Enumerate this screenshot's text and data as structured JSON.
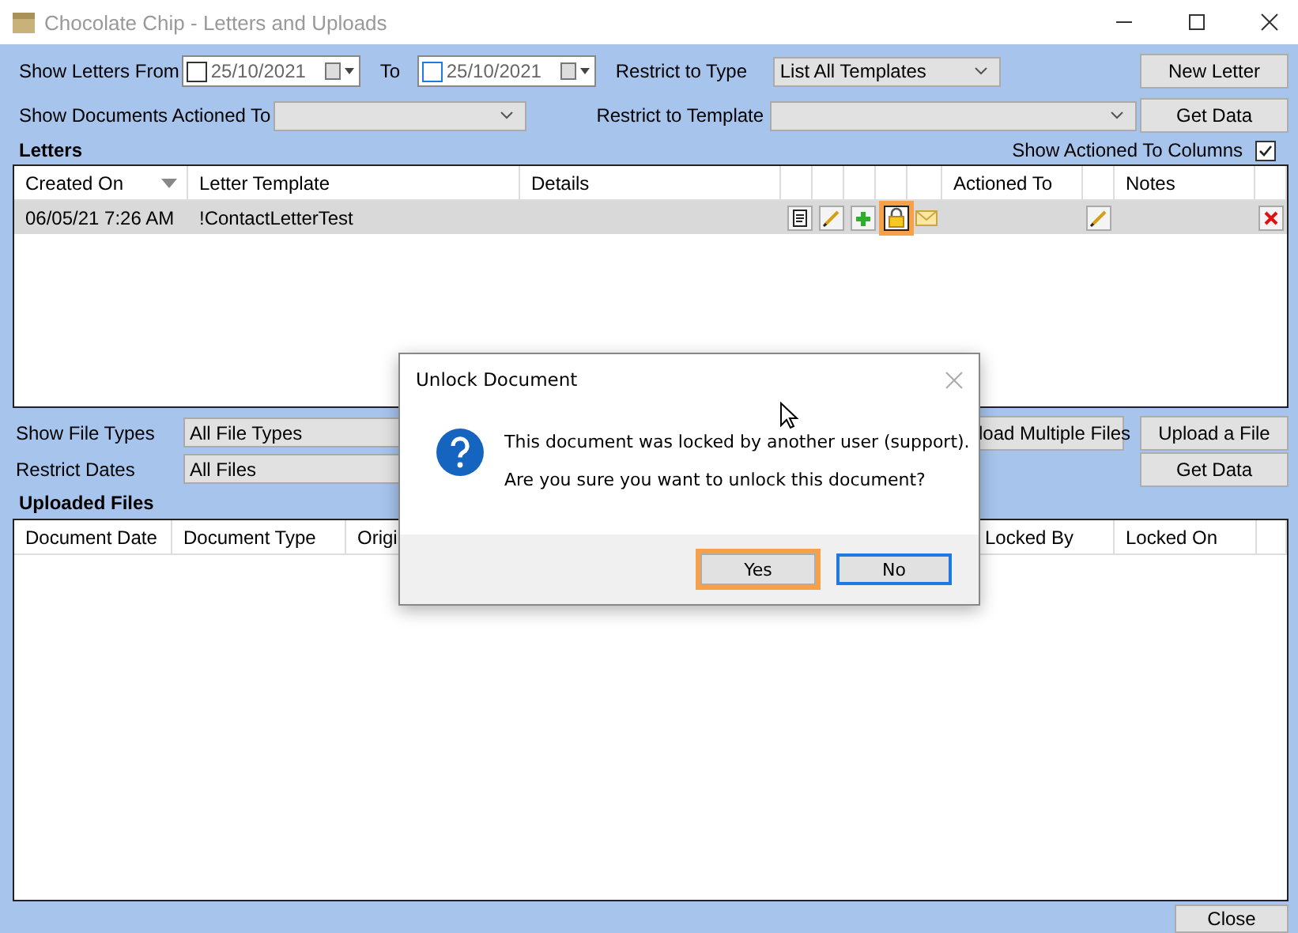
{
  "window": {
    "title": "Chocolate Chip - Letters and Uploads"
  },
  "letter_filters": {
    "from_label": "Show Letters From",
    "from_date": {
      "value": "25/10/2021",
      "checked": false
    },
    "to_label": "To",
    "to_date": {
      "value": "25/10/2021",
      "checked": false
    },
    "type_label": "Restrict to Type",
    "type_value": "List All Templates",
    "actioned_label": "Show Documents Actioned To",
    "template_label": "Restrict to Template"
  },
  "letter_buttons": [
    "New Letter",
    "Get Data"
  ],
  "letters": {
    "title": "Letters",
    "show_actioned": {
      "label": "Show Actioned To Columns",
      "checked": true
    },
    "columns": [
      {
        "label": "Created On",
        "sorted": true
      },
      {
        "label": "Letter Template",
        "sorted": false
      },
      {
        "label": "Details",
        "sorted": false
      },
      {
        "label": "Actioned To",
        "sorted": false
      },
      {
        "label": "Notes",
        "sorted": false
      }
    ],
    "rows": [
      {
        "created_on": "06/05/21 7:26 AM",
        "template": "!ContactLetterTest",
        "selected": true,
        "actions": [
          {
            "kind": "document",
            "highlighted": false
          },
          {
            "kind": "pencil",
            "highlighted": false
          },
          {
            "kind": "plus",
            "highlighted": false
          },
          {
            "kind": "lock",
            "highlighted": true
          },
          {
            "kind": "envelope",
            "highlighted": false
          }
        ]
      }
    ]
  },
  "file_filters": {
    "type_label": "Show File Types",
    "type_value": "All File Types",
    "dates_label": "Restrict Dates",
    "dates_value": "All Files"
  },
  "file_buttons": [
    "load Multiple Files",
    "Upload a File",
    "Get Data"
  ],
  "uploaded_files": {
    "title": "Uploaded Files",
    "columns": [
      "Document Date",
      "Document Type",
      "Origi",
      "Locked By",
      "Locked On"
    ]
  },
  "close_button": "Close",
  "dialog": {
    "title": "Unlock Document",
    "message": "This document was locked by another user (support).",
    "question": "Are you sure you want to unlock this document?",
    "buttons": [
      {
        "label": "Yes",
        "highlighted": true,
        "focused": false
      },
      {
        "label": "No",
        "highlighted": false,
        "focused": true
      }
    ]
  }
}
